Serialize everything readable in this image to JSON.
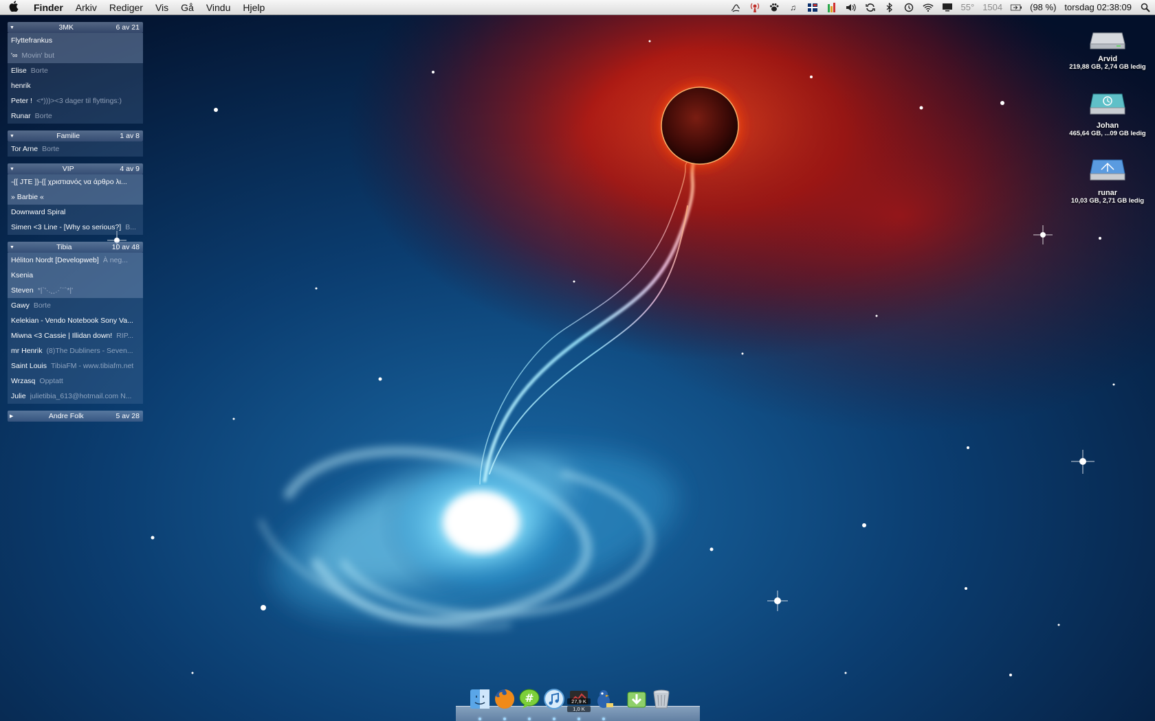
{
  "menubar": {
    "apple_glyph": "",
    "items": [
      "Finder",
      "Arkiv",
      "Rediger",
      "Vis",
      "Gå",
      "Vindu",
      "Hjelp"
    ],
    "tray_icons": [
      "script-icon",
      "broadcast-icon",
      "growl-paw-icon",
      "music-note-icon",
      "flag-icon",
      "meter-icon",
      "volume-icon",
      "sync-icon",
      "bluetooth-icon",
      "time-machine-icon",
      "wifi-icon",
      "display-icon"
    ],
    "temperature": "55°",
    "fan_speed": "1504",
    "battery": "(98 %)",
    "clock": "torsdag 02:38:09"
  },
  "contact_groups": [
    {
      "name": "3MK",
      "count": "6 av 21",
      "expanded": true,
      "contacts": [
        {
          "name": "Flyttefrankus",
          "status": "",
          "highlight": true
        },
        {
          "name": "'∞",
          "status": "Movin' but",
          "highlight": true
        },
        {
          "name": "Elise",
          "status": "Borte",
          "highlight": false
        },
        {
          "name": "henrik",
          "status": "",
          "highlight": false
        },
        {
          "name": "Peter !",
          "status": "<*)))><3 dager til flyttings:)",
          "highlight": false
        },
        {
          "name": "Runar",
          "status": "Borte",
          "highlight": false
        }
      ]
    },
    {
      "name": "Familie",
      "count": "1 av 8",
      "expanded": true,
      "contacts": [
        {
          "name": "Tor Arne",
          "status": "Borte",
          "highlight": false
        }
      ]
    },
    {
      "name": "VIP",
      "count": "4 av 9",
      "expanded": true,
      "contacts": [
        {
          "name": "-{[ JTE ]}-{[ χριστιανός να άρθρο λι...",
          "status": "",
          "highlight": true
        },
        {
          "name": "» Barbie «",
          "status": "",
          "highlight": true
        },
        {
          "name": "Downward Spiral",
          "status": "",
          "highlight": false
        },
        {
          "name": "Simen <3 Line - [Why so serious?]",
          "status": "B...",
          "highlight": false
        }
      ]
    },
    {
      "name": "Tibia",
      "count": "10 av 48",
      "expanded": true,
      "contacts": [
        {
          "name": "Héliton Nordt [Developweb]",
          "status": "À neg...",
          "highlight": true
        },
        {
          "name": "Ksenia",
          "status": "",
          "highlight": true
        },
        {
          "name": "Steven",
          "status": "*|`'·.¸¸.·´¨`*|'",
          "highlight": true
        },
        {
          "name": "Gawy",
          "status": "Borte",
          "highlight": false
        },
        {
          "name": "Kelekian - Vendo Notebook Sony Va...",
          "status": "",
          "highlight": false
        },
        {
          "name": "Miwna <3 Cassie | Illidan down!",
          "status": "RIP...",
          "highlight": false
        },
        {
          "name": "mr Henrik",
          "status": "(8)The Dubliners - Seven...",
          "highlight": false
        },
        {
          "name": "Saint Louis",
          "status": "TibiaFM - www.tibiafm.net",
          "highlight": false
        },
        {
          "name": "Wrzasq",
          "status": "Opptatt",
          "highlight": false
        },
        {
          "name": "Julie",
          "status": "julietibia_613@hotmail.com N...",
          "highlight": false
        }
      ]
    },
    {
      "name": "Andre Folk",
      "count": "5 av 28",
      "expanded": false,
      "contacts": []
    }
  ],
  "volumes": [
    {
      "name": "Arvid",
      "info": "219,88 GB, 2,74 GB ledig",
      "icon": "hard-drive-icon"
    },
    {
      "name": "Johan",
      "info": "465,64 GB, ...09 GB ledig",
      "icon": "time-machine-drive-icon"
    },
    {
      "name": "runar",
      "info": "10,03 GB, 2,71 GB ledig",
      "icon": "network-drive-icon"
    }
  ],
  "dock": {
    "items": [
      {
        "name": "finder",
        "icon": "finder-icon",
        "badge": ""
      },
      {
        "name": "firefox",
        "icon": "firefox-icon",
        "badge": ""
      },
      {
        "name": "adium",
        "icon": "chat-icon",
        "badge": ""
      },
      {
        "name": "itunes",
        "icon": "itunes-icon",
        "badge": ""
      },
      {
        "name": "network-monitor",
        "icon": "monitor-icon",
        "badge_upper": "27,9 K",
        "badge_lower": "1,0 K"
      },
      {
        "name": "cyberduck",
        "icon": "bird-icon",
        "badge": ""
      },
      {
        "name": "downloads",
        "icon": "download-icon",
        "badge": ""
      },
      {
        "name": "trash",
        "icon": "trash-icon",
        "badge": ""
      }
    ]
  },
  "colors": {
    "space_dark": "#04112a",
    "space_blue": "#0d4f8a",
    "nebula_red": "#b5160a",
    "galaxy_cyan": "#7fe0ff",
    "menubar_text": "#111111"
  }
}
